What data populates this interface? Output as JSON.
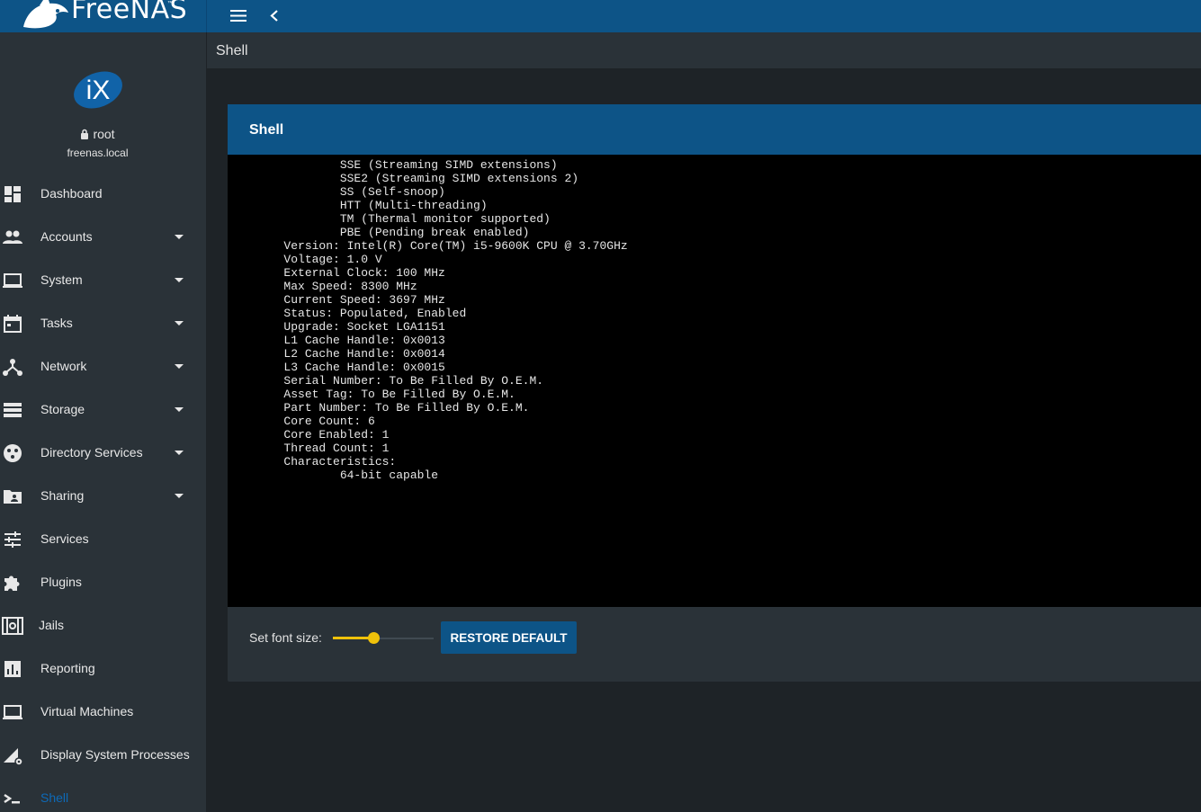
{
  "app": {
    "logo_text": "FreeNAS",
    "logo_tm": "™"
  },
  "topbar": {
    "menu_icon": "menu-icon",
    "back_icon": "chevron-left-icon"
  },
  "user": {
    "name": "root",
    "host": "freenas.local",
    "avatar_text": "iX"
  },
  "sidebar": {
    "items": [
      {
        "label": "Dashboard",
        "icon": "dashboard-icon",
        "expandable": false
      },
      {
        "label": "Accounts",
        "icon": "people-icon",
        "expandable": true
      },
      {
        "label": "System",
        "icon": "laptop-icon",
        "expandable": true
      },
      {
        "label": "Tasks",
        "icon": "calendar-icon",
        "expandable": true
      },
      {
        "label": "Network",
        "icon": "network-icon",
        "expandable": true
      },
      {
        "label": "Storage",
        "icon": "storage-icon",
        "expandable": true
      },
      {
        "label": "Directory Services",
        "icon": "directory-services-icon",
        "expandable": true
      },
      {
        "label": "Sharing",
        "icon": "shared-folder-icon",
        "expandable": true
      },
      {
        "label": "Services",
        "icon": "tune-icon",
        "expandable": false
      },
      {
        "label": "Plugins",
        "icon": "puzzle-icon",
        "expandable": false
      },
      {
        "label": "Jails",
        "icon": "jail-icon",
        "expandable": false
      },
      {
        "label": "Reporting",
        "icon": "bar-chart-icon",
        "expandable": false
      },
      {
        "label": "Virtual Machines",
        "icon": "laptop-icon",
        "expandable": false
      },
      {
        "label": "Display System Processes",
        "icon": "processes-icon",
        "expandable": false
      },
      {
        "label": "Shell",
        "icon": "terminal-icon",
        "expandable": false,
        "active": true
      }
    ]
  },
  "page": {
    "title": "Shell"
  },
  "shell": {
    "title": "Shell",
    "terminal_lines": [
      "                SSE (Streaming SIMD extensions)",
      "                SSE2 (Streaming SIMD extensions 2)",
      "                SS (Self-snoop)",
      "                HTT (Multi-threading)",
      "                TM (Thermal monitor supported)",
      "                PBE (Pending break enabled)",
      "        Version: Intel(R) Core(TM) i5-9600K CPU @ 3.70GHz",
      "        Voltage: 1.0 V",
      "        External Clock: 100 MHz",
      "        Max Speed: 8300 MHz",
      "        Current Speed: 3697 MHz",
      "        Status: Populated, Enabled",
      "        Upgrade: Socket LGA1151",
      "        L1 Cache Handle: 0x0013",
      "        L2 Cache Handle: 0x0014",
      "        L3 Cache Handle: 0x0015",
      "        Serial Number: To Be Filled By O.E.M.",
      "        Asset Tag: To Be Filled By O.E.M.",
      "        Part Number: To Be Filled By O.E.M.",
      "        Core Count: 6",
      "        Core Enabled: 1",
      "        Thread Count: 1",
      "        Characteristics:",
      "                64-bit capable"
    ],
    "font_size_label": "Set font size:",
    "font_size_level": 0.4,
    "restore_label": "RESTORE DEFAULT"
  },
  "colors": {
    "brand": "#0d5487",
    "sidebar_bg": "#2a3238",
    "page_bg": "#1e2327",
    "slider_accent": "#f0c20a",
    "active_nav": "#0d6ab8"
  }
}
